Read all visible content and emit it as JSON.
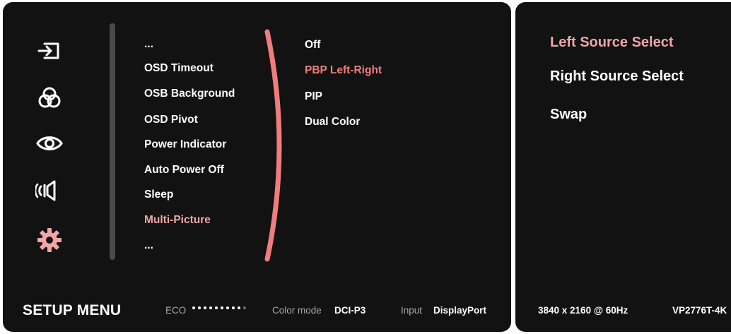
{
  "colors": {
    "panel_bg": "#121212",
    "accent": "#ef7d7d",
    "active_text": "#f0a6a6",
    "text": "#ffffff",
    "muted": "#a8a8a8"
  },
  "nav_icons": [
    "input-icon",
    "color-icon",
    "eye-icon",
    "audio-icon",
    "gear-icon"
  ],
  "active_nav": "gear-icon",
  "menu": {
    "items": [
      "...",
      "OSD Timeout",
      "OSB Background",
      "OSD Pivot",
      "Power Indicator",
      "Auto Power Off",
      "Sleep",
      "Multi-Picture",
      "..."
    ],
    "selected": "Multi-Picture"
  },
  "submenu": {
    "items": [
      "Off",
      "PBP Left-Right",
      "PIP",
      "Dual Color"
    ],
    "selected": "PBP Left-Right"
  },
  "footer": {
    "title": "SETUP MENU",
    "eco_label": "ECO",
    "eco_level": 0.9,
    "color_mode_label": "Color mode",
    "color_mode_value": "DCI-P3",
    "input_label": "Input",
    "input_value": "DisplayPort"
  },
  "side": {
    "items": [
      "Left Source Select",
      "Right Source Select",
      "Swap"
    ],
    "selected": "Left Source Select",
    "resolution": "3840 x 2160 @ 60Hz",
    "model": "VP2776T-4K"
  }
}
